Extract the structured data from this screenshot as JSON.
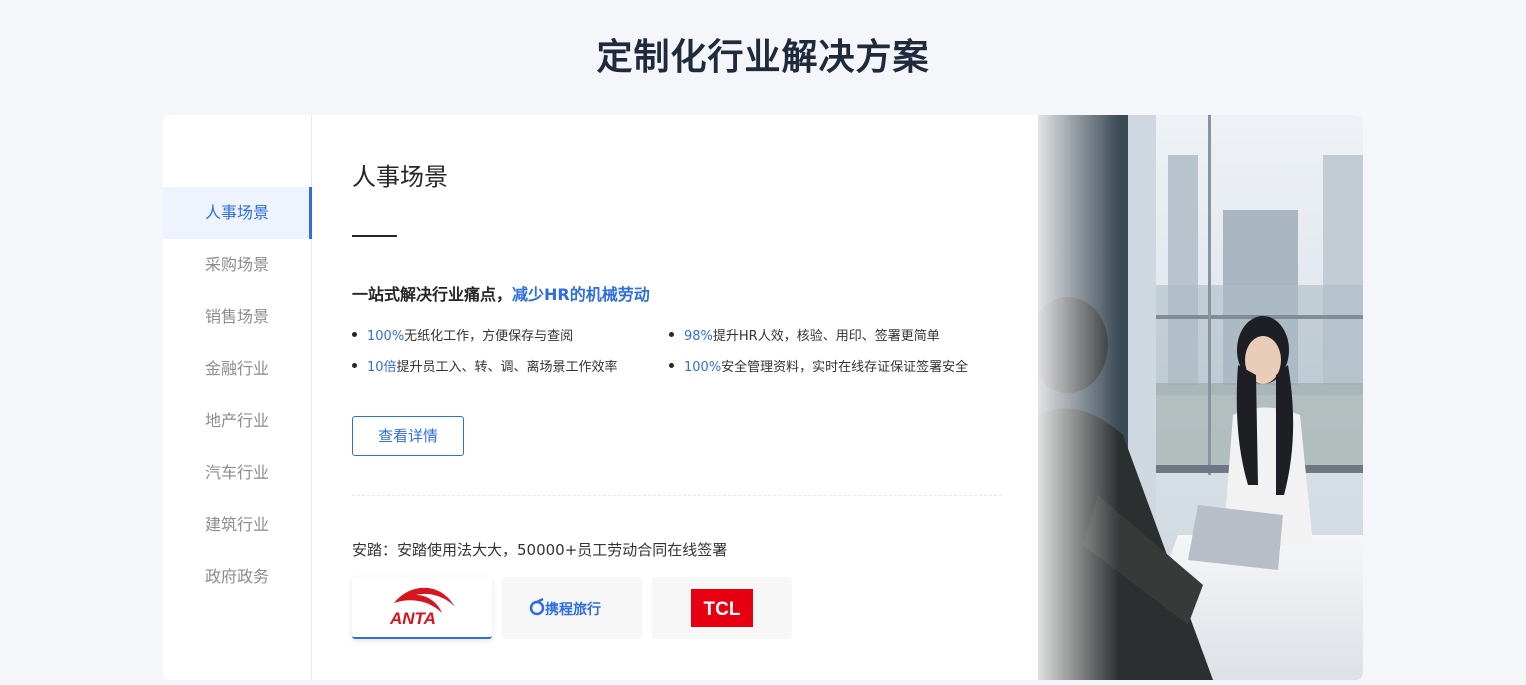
{
  "section": {
    "title": "定制化行业解决方案"
  },
  "sidebar": {
    "items": [
      {
        "label": "人事场景",
        "active": true
      },
      {
        "label": "采购场景"
      },
      {
        "label": "销售场景"
      },
      {
        "label": "金融行业"
      },
      {
        "label": "地产行业"
      },
      {
        "label": "汽车行业"
      },
      {
        "label": "建筑行业"
      },
      {
        "label": "政府政务"
      }
    ]
  },
  "scene": {
    "title": "人事场景",
    "headline_prefix": "一站式解决行业痛点，",
    "headline_highlight": "减少HR的机械劳动",
    "features": [
      {
        "num": "100%",
        "text": "无纸化工作，方便保存与查阅"
      },
      {
        "num": "98%",
        "text": "提升HR人效，核验、用印、签署更简单"
      },
      {
        "num": "10倍",
        "text": "提升员工入、转、调、离场景工作效率"
      },
      {
        "num": "100%",
        "text": "安全管理资料，实时在线存证保证签署安全"
      }
    ],
    "detail_button": "查看详情",
    "case_text": "安踏：安踏使用法大大，50000+员工劳动合同在线签署",
    "logos": [
      {
        "name": "anta-logo",
        "text": "ANTA",
        "color": "#d9141e",
        "active": true
      },
      {
        "name": "ctrip-logo",
        "text": "携程旅行",
        "color": "#2f6ee0"
      },
      {
        "name": "tcl-logo",
        "text": "TCL",
        "color": "#e60012"
      }
    ]
  },
  "colors": {
    "accent": "#2f6ee0",
    "background": "#f4f6f9",
    "title": "#1f2a3d"
  }
}
